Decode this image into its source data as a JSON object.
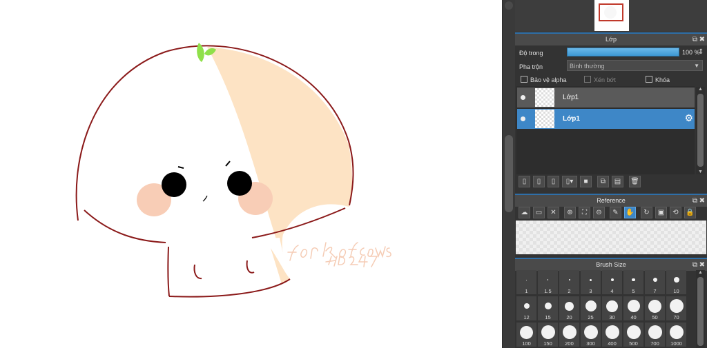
{
  "layer_panel": {
    "title": "Lớp",
    "opacity_label": "Độ trong",
    "opacity_value": "100 %",
    "opacity_fraction": 1.0,
    "blend_label": "Pha trộn",
    "blend_value": "Bình thường",
    "protect_alpha": "Bảo vệ alpha",
    "clipping": "Xén bớt",
    "lock": "Khóa",
    "layers": [
      {
        "name": "Lớp1",
        "selected": false
      },
      {
        "name": "Lớp1",
        "selected": true
      }
    ]
  },
  "reference_panel": {
    "title": "Reference"
  },
  "brush_panel": {
    "title": "Brush Size",
    "sizes": [
      "1",
      "1.5",
      "2",
      "3",
      "4",
      "5",
      "7",
      "10",
      "12",
      "15",
      "20",
      "25",
      "30",
      "40",
      "50",
      "70",
      "100",
      "150",
      "200",
      "300",
      "400",
      "500",
      "700",
      "1000"
    ]
  },
  "artwork": {
    "signature_text": "for Kofcows",
    "signature_sub": "HD247",
    "colors": {
      "outline": "#8b1a1a",
      "shade": "#fde3c4",
      "blush": "#f8cdb6",
      "leaf": "#8fe04a"
    }
  },
  "accent": "#3e87c7"
}
